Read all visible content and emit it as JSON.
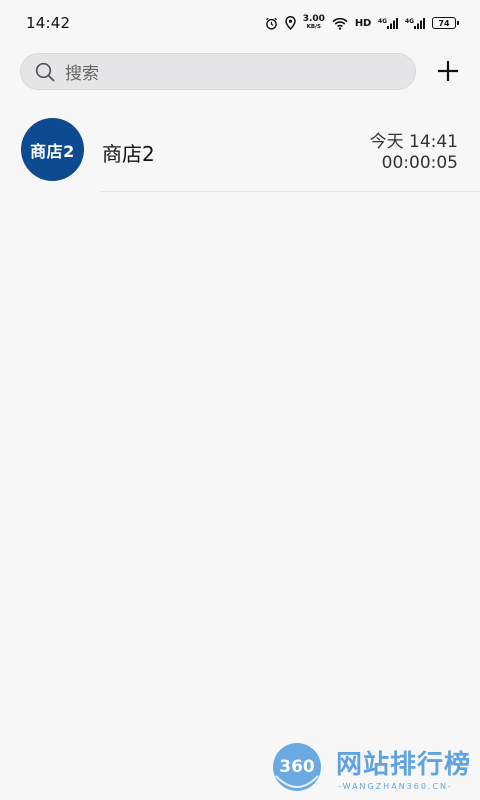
{
  "status_bar": {
    "time": "14:42",
    "net_speed_value": "3.00",
    "net_speed_unit": "KB/S",
    "hd_label": "HD",
    "signal1_label": "4G",
    "signal2_label": "4G",
    "battery_level": "74"
  },
  "search": {
    "placeholder": "搜索"
  },
  "list": {
    "items": [
      {
        "avatar_text": "商店2",
        "name": "商店2",
        "time": "今天 14:41",
        "duration": "00:00:05"
      }
    ]
  },
  "watermark": {
    "logo_number": "360",
    "title": "网站排行榜",
    "subtitle": "-WANGZHAN360.CN-"
  },
  "colors": {
    "background": "#f7f7f8",
    "avatar": "#0e4a8f",
    "watermark": "#3b8fd9"
  }
}
